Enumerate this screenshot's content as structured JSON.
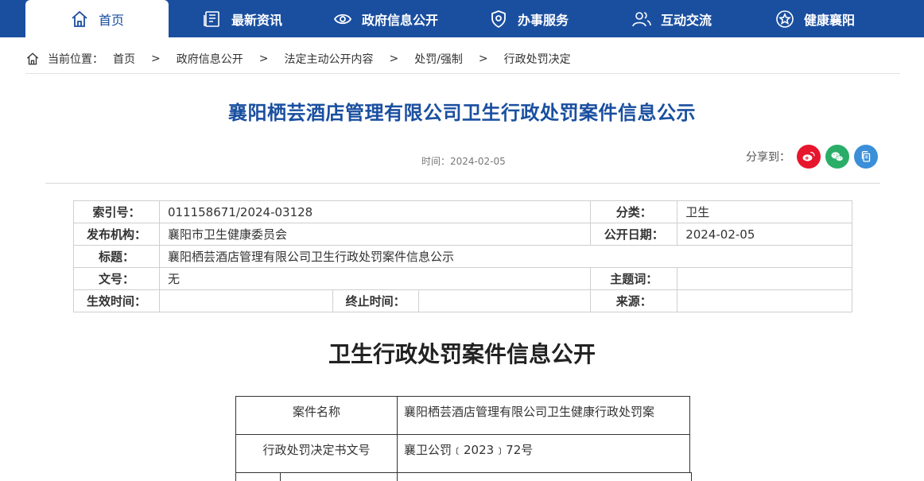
{
  "nav": {
    "items": [
      {
        "label": "首页",
        "icon": "home-icon"
      },
      {
        "label": "最新资讯",
        "icon": "news-icon"
      },
      {
        "label": "政府信息公开",
        "icon": "eye-icon"
      },
      {
        "label": "办事服务",
        "icon": "shield-icon"
      },
      {
        "label": "互动交流",
        "icon": "users-icon"
      },
      {
        "label": "健康襄阳",
        "icon": "star-icon"
      }
    ],
    "active_index": 0
  },
  "breadcrumb": {
    "prefix": "当前位置：",
    "sep": ">",
    "items": [
      "首页",
      "政府信息公开",
      "法定主动公开内容",
      "处罚/强制",
      "行政处罚决定"
    ]
  },
  "article": {
    "title": "襄阳栖芸酒店管理有限公司卫生行政处罚案件信息公示",
    "time": "时间：2024-02-05",
    "share_label": "分享到：",
    "share_icons": [
      "weibo-icon",
      "wechat-icon",
      "copy-icon"
    ]
  },
  "info_table": {
    "index_label": "索引号：",
    "index_value": "011158671/2024-03128",
    "category_label": "分类：",
    "category_value": "卫生",
    "publisher_label": "发布机构：",
    "publisher_value": "襄阳市卫生健康委员会",
    "date_label": "公开日期：",
    "date_value": "2024-02-05",
    "title_label": "标题：",
    "title_value": "襄阳栖芸酒店管理有限公司卫生行政处罚案件信息公示",
    "docno_label": "文号：",
    "docno_value": "无",
    "keyword_label": "主题词：",
    "keyword_value": "",
    "effective_label": "生效时间：",
    "effective_value": "",
    "expire_label": "终止时间：",
    "expire_value": "",
    "source_label": "来源：",
    "source_value": ""
  },
  "section": {
    "title": "卫生行政处罚案件信息公开",
    "rows": [
      {
        "key": "案件名称",
        "value": "襄阳栖芸酒店管理有限公司卫生健康行政处罚案"
      },
      {
        "key": "行政处罚决定书文号",
        "value": "襄卫公罚﹝2023﹞72号"
      }
    ]
  },
  "colors": {
    "brand": "#1a4fa0",
    "weibo": "#e6162d",
    "wechat": "#2aae67",
    "copy": "#3b8fd9"
  }
}
